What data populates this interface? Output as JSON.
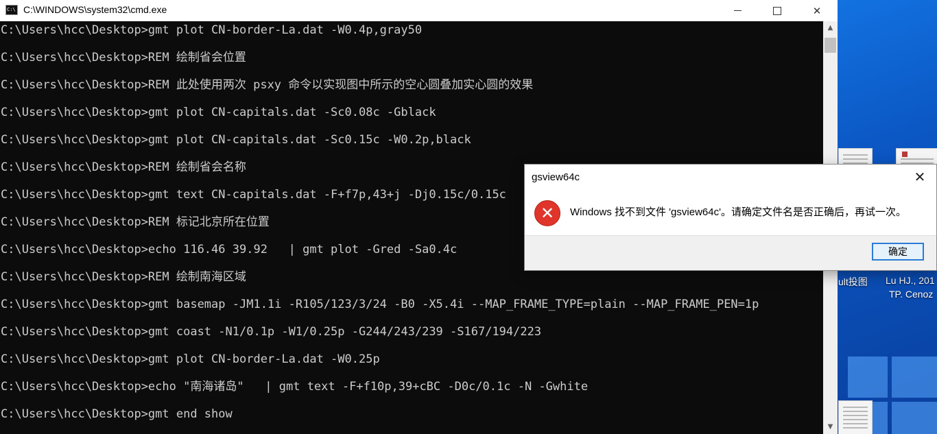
{
  "window": {
    "title": "C:\\WINDOWS\\system32\\cmd.exe",
    "icon": "cmd-app-icon",
    "icon_text": "C:\\",
    "minimize_icon": "minimize-icon",
    "maximize_icon": "maximize-icon",
    "close_glyph": "✕"
  },
  "console": {
    "lines": [
      "C:\\Users\\hcc\\Desktop>gmt plot CN-border-La.dat -W0.4p,gray50",
      "C:\\Users\\hcc\\Desktop>REM 绘制省会位置",
      "C:\\Users\\hcc\\Desktop>REM 此处使用两次 psxy 命令以实现图中所示的空心圆叠加实心圆的效果",
      "C:\\Users\\hcc\\Desktop>gmt plot CN-capitals.dat -Sc0.08c -Gblack",
      "C:\\Users\\hcc\\Desktop>gmt plot CN-capitals.dat -Sc0.15c -W0.2p,black",
      "C:\\Users\\hcc\\Desktop>REM 绘制省会名称",
      "C:\\Users\\hcc\\Desktop>gmt text CN-capitals.dat -F+f7p,43+j -Dj0.15c/0.15c",
      "C:\\Users\\hcc\\Desktop>REM 标记北京所在位置",
      "C:\\Users\\hcc\\Desktop>echo 116.46 39.92   | gmt plot -Gred -Sa0.4c",
      "C:\\Users\\hcc\\Desktop>REM 绘制南海区域",
      "C:\\Users\\hcc\\Desktop>gmt basemap -JM1.1i -R105/123/3/24 -B0 -X5.4i --MAP_FRAME_TYPE=plain --MAP_FRAME_PEN=1p",
      "C:\\Users\\hcc\\Desktop>gmt coast -N1/0.1p -W1/0.25p -G244/243/239 -S167/194/223",
      "C:\\Users\\hcc\\Desktop>gmt plot CN-border-La.dat -W0.25p",
      "C:\\Users\\hcc\\Desktop>echo \"南海诸岛\"   | gmt text -F+f10p,39+cBC -D0c/0.1c -N -Gwhite",
      "C:\\Users\\hcc\\Desktop>gmt end show"
    ]
  },
  "scrollbar": {
    "up_glyph": "▲",
    "down_glyph": "▼"
  },
  "dialog": {
    "title": "gsview64c",
    "close_glyph": "✕",
    "icon": "error-icon",
    "icon_glyph": "✕",
    "message": "Windows 找不到文件 'gsview64c'。请确定文件名是否正确后，再试一次。",
    "ok_label": "确定"
  },
  "desktop": {
    "labels": [
      "ult投图",
      "Lu HJ., 201",
      "TP. Cenoz"
    ]
  },
  "colors": {
    "console_bg": "#0c0c0c",
    "console_text": "#cccccc",
    "error_red": "#e0352b",
    "accent_blue": "#2a7bd6"
  }
}
